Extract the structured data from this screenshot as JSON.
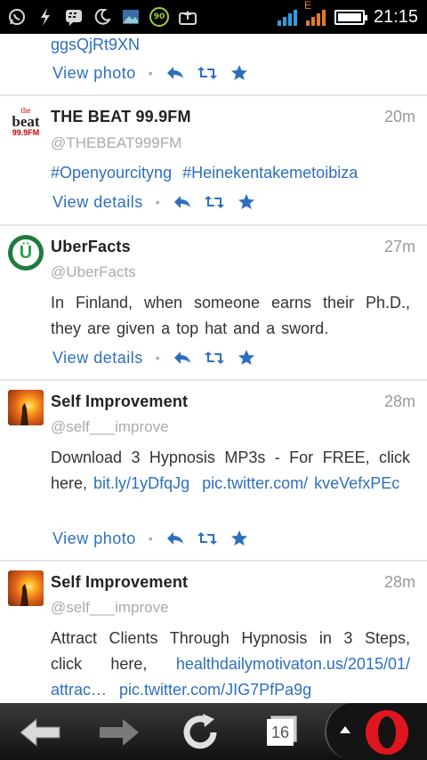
{
  "status_bar": {
    "clock": "21:15",
    "badge_value": "90",
    "network_type": "E",
    "signal_color": "#2f9fe0",
    "icons": [
      "whatsapp-icon",
      "flash-icon",
      "bbm-icon",
      "moon-icon",
      "gallery-icon",
      "badge-90-icon",
      "upload-icon"
    ]
  },
  "accent_color": "#2d6fbf",
  "tweets": [
    {
      "text_line": "ggsQjRt9XN",
      "action_label": "View  photo"
    },
    {
      "name": "THE  BEAT  99.9FM",
      "time": "20m",
      "handle": "@THEBEAT999FM",
      "hashtags": [
        "#Openyourcityng",
        "#Heinekentakemetoibiza"
      ],
      "action_label": "View  details",
      "avatar_line1": "the",
      "avatar_line2": "beat",
      "avatar_line3": "99.9FM"
    },
    {
      "name": "UberFacts",
      "time": "27m",
      "handle": "@UberFacts",
      "text": "In Finland, when someone earns their Ph.D., they are given a top hat and a sword.",
      "action_label": "View  details",
      "avatar_letter": "Ü"
    },
    {
      "name": "Self  Improvement",
      "time": "28m",
      "handle": "@self___improve",
      "text": "Download 3 Hypnosis MP3s - For FREE, click here,",
      "link1": "bit.ly/1yDfqJg",
      "link2": "pic.twitter.com/",
      "link3": "kveVefxPEc",
      "action_label": "View  photo"
    },
    {
      "name": "Self  Improvement",
      "time": "28m",
      "handle": "@self___improve",
      "text": "Attract Clients Through Hypnosis in 3 Steps, click here,",
      "link1": "healthdailymotivaton.us/2015/01/",
      "link2": "attrac…",
      "link3": "pic.twitter.com/JIG7PfPa9g"
    }
  ],
  "toolbar": {
    "tab_count": "16",
    "icons": [
      "back-icon",
      "forward-icon",
      "reload-icon",
      "tabs-icon",
      "menu-up-icon",
      "opera-logo-icon"
    ]
  }
}
